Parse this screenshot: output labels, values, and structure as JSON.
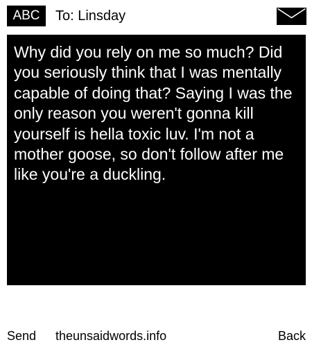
{
  "header": {
    "mode": "ABC",
    "recipient": "To: Linsday",
    "icon": "envelope-icon"
  },
  "message": {
    "text": "Why did you rely on me so much? Did you seriously think that I was mentally capable of doing that? Saying I was the only reason you weren't gonna kill yourself is hella toxic luv. I'm not a mother goose, so don't follow after me like you're a duckling."
  },
  "footer": {
    "left_softkey": "Send",
    "site": "theunsaidwords.info",
    "right_softkey": "Back"
  },
  "colors": {
    "background": "#ffffff",
    "message_background": "#000000",
    "message_text": "#ffffff",
    "text": "#000000"
  }
}
